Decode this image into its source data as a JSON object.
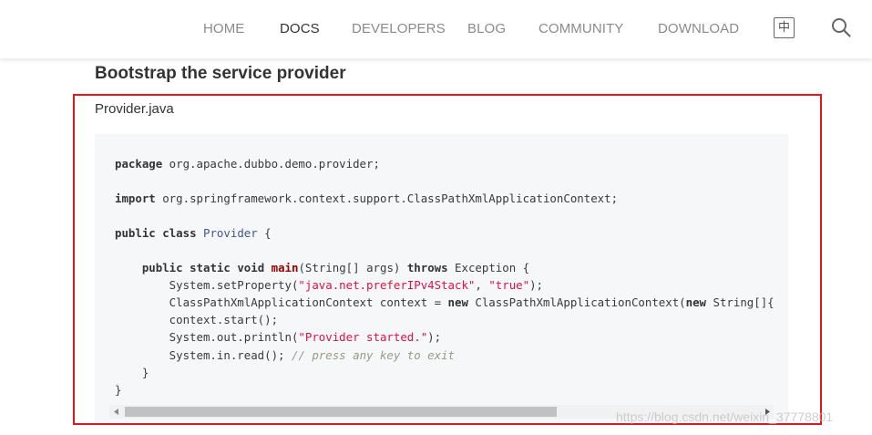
{
  "nav": {
    "items": [
      {
        "label": "HOME",
        "active": false
      },
      {
        "label": "DOCS",
        "active": true
      },
      {
        "label": "DEVELOPERS",
        "active": false
      },
      {
        "label": "BLOG",
        "active": false
      },
      {
        "label": "COMMUNITY",
        "active": false
      },
      {
        "label": "DOWNLOAD",
        "active": false
      }
    ],
    "lang_toggle": "中",
    "search_icon": "search-icon"
  },
  "content": {
    "section_title": "Bootstrap the service provider",
    "file_name": "Provider.java",
    "code_lines": [
      "package org.apache.dubbo.demo.provider;",
      "",
      "import org.springframework.context.support.ClassPathXmlApplicationContext;",
      "",
      "public class Provider {",
      "",
      "    public static void main(String[] args) throws Exception {",
      "        System.setProperty(\"java.net.preferIPv4Stack\", \"true\");",
      "        ClassPathXmlApplicationContext context = new ClassPathXmlApplicationContext(new String[]{",
      "        context.start();",
      "        System.out.println(\"Provider started.\");",
      "        System.in.read(); // press any key to exit",
      "    }",
      "}"
    ]
  },
  "colors": {
    "highlight_border": "#e8141c",
    "code_background": "#f6f7f9",
    "string": "#dd1144",
    "comment": "#999988",
    "class_name": "#445588"
  },
  "watermark": "https://blog.csdn.net/weixin_37778801"
}
